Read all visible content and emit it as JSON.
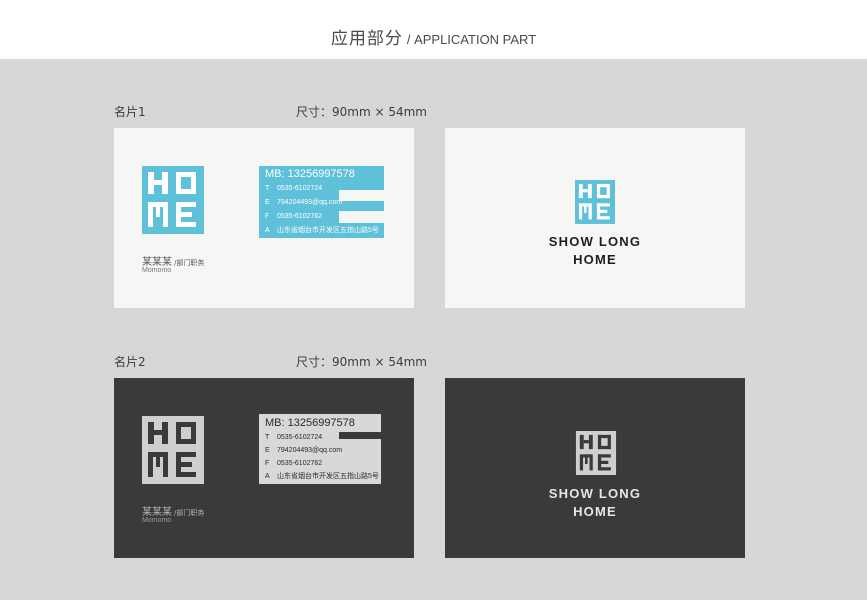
{
  "header": {
    "title_cn": "应用部分",
    "title_en": "/ APPLICATION PART"
  },
  "sections": [
    {
      "label": "名片1",
      "size": "尺寸：90mm × 54mm"
    },
    {
      "label": "名片2",
      "size": "尺寸：90mm × 54mm"
    }
  ],
  "card": {
    "mb": "MB: 13256997578",
    "rows": [
      {
        "key": "T",
        "value": "0535-6102724"
      },
      {
        "key": "E",
        "value": "794204493@qq.com"
      },
      {
        "key": "F",
        "value": "0535-6102762"
      },
      {
        "key": "A",
        "value": "山东省烟台市开发区五指山路5号"
      }
    ],
    "name": "某某某",
    "role": "/部门职务",
    "name_en": "Momomo",
    "brand_line1": "SHOW LONG",
    "brand_line2": "HOME",
    "logo_text": "HOME"
  },
  "colors": {
    "accent": "#5ec1d9",
    "light_card": "#f6f6f5",
    "dark_card": "#3a3b39",
    "dark_logo": "#cfcfcf",
    "background": "#d7d8d6"
  }
}
